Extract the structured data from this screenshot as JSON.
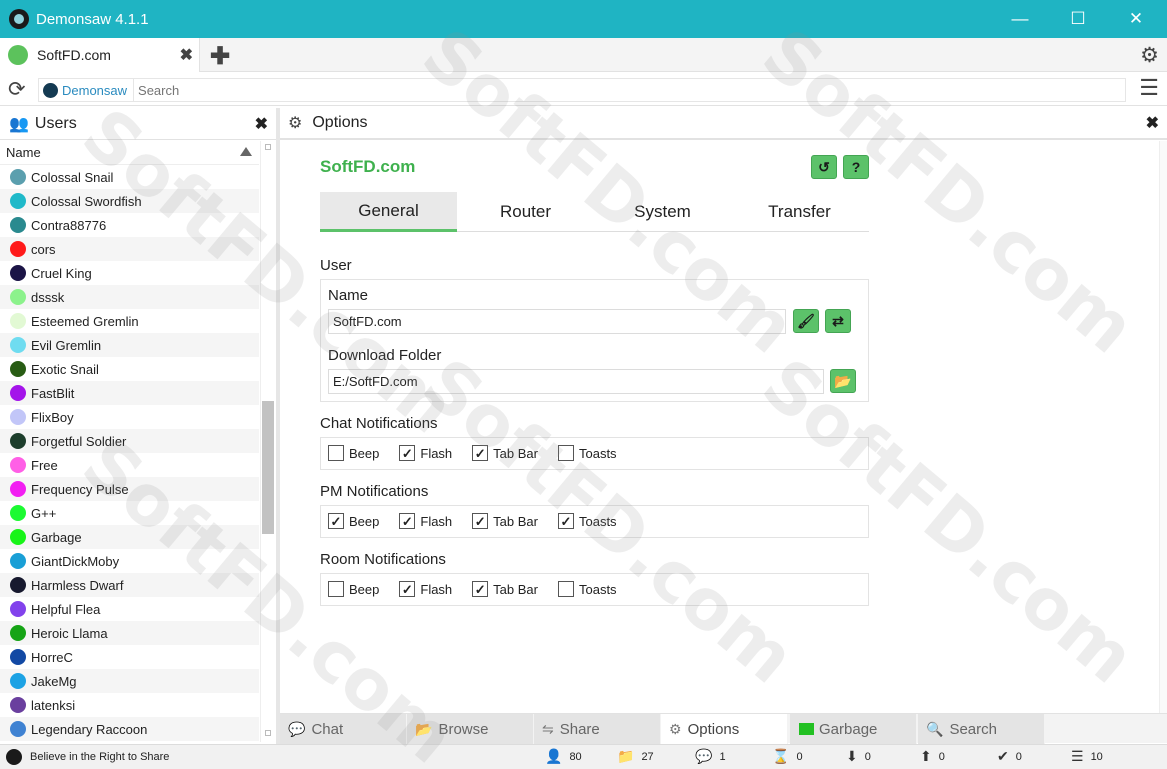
{
  "window": {
    "title": "Demonsaw 4.1.1",
    "minimize": "—",
    "maximize": "☐",
    "close": "✕"
  },
  "tab": {
    "label": "SoftFD.com",
    "close": "✖",
    "add": "✚"
  },
  "address": {
    "site": "Demonsaw",
    "placeholder": "Search"
  },
  "users": {
    "title": "Users",
    "column": "Name",
    "list": [
      {
        "name": "Colossal Snail",
        "color": "#5b9fae"
      },
      {
        "name": "Colossal Swordfish",
        "color": "#1fb9c9"
      },
      {
        "name": "Contra88776",
        "color": "#2a8a8f"
      },
      {
        "name": "cors",
        "color": "#ff1a1a"
      },
      {
        "name": "Cruel King",
        "color": "#1b1446"
      },
      {
        "name": "dsssk",
        "color": "#8cf28c"
      },
      {
        "name": "Esteemed Gremlin",
        "color": "#e2f9d4"
      },
      {
        "name": "Evil Gremlin",
        "color": "#6fdcf0"
      },
      {
        "name": "Exotic Snail",
        "color": "#285c14"
      },
      {
        "name": "FastBlit",
        "color": "#a414ea"
      },
      {
        "name": "FlixBoy",
        "color": "#c2c6f8"
      },
      {
        "name": "Forgetful Soldier",
        "color": "#1d3e2c"
      },
      {
        "name": "Free",
        "color": "#ff5fe6"
      },
      {
        "name": "Frequency Pulse",
        "color": "#f21ef2"
      },
      {
        "name": "G++",
        "color": "#1cfa32"
      },
      {
        "name": "Garbage",
        "color": "#18f418"
      },
      {
        "name": "GiantDickMoby",
        "color": "#199fd6"
      },
      {
        "name": "Harmless Dwarf",
        "color": "#17192e"
      },
      {
        "name": "Helpful Flea",
        "color": "#8242ec"
      },
      {
        "name": "Heroic Llama",
        "color": "#16a416"
      },
      {
        "name": "HorreC",
        "color": "#1249a4"
      },
      {
        "name": "JakeMg",
        "color": "#1ca2e4"
      },
      {
        "name": "latenksi",
        "color": "#6a3f9e"
      },
      {
        "name": "Legendary Raccoon",
        "color": "#3f82d2"
      }
    ]
  },
  "options": {
    "header": "Options",
    "title": "SoftFD.com",
    "tabs": [
      "General",
      "Router",
      "System",
      "Transfer"
    ],
    "user_section": "User",
    "name_label": "Name",
    "name_value": "SoftFD.com",
    "download_label": "Download Folder",
    "download_value": "E:/SoftFD.com",
    "notifications": [
      {
        "title": "Chat Notifications",
        "items": [
          {
            "label": "Beep",
            "checked": false
          },
          {
            "label": "Flash",
            "checked": true
          },
          {
            "label": "Tab Bar",
            "checked": true
          },
          {
            "label": "Toasts",
            "checked": false
          }
        ]
      },
      {
        "title": "PM Notifications",
        "items": [
          {
            "label": "Beep",
            "checked": true
          },
          {
            "label": "Flash",
            "checked": true
          },
          {
            "label": "Tab Bar",
            "checked": true
          },
          {
            "label": "Toasts",
            "checked": true
          }
        ]
      },
      {
        "title": "Room Notifications",
        "items": [
          {
            "label": "Beep",
            "checked": false
          },
          {
            "label": "Flash",
            "checked": true
          },
          {
            "label": "Tab Bar",
            "checked": true
          },
          {
            "label": "Toasts",
            "checked": false
          }
        ]
      }
    ]
  },
  "bottom_tabs": [
    "Chat",
    "Browse",
    "Share",
    "Options",
    "Garbage",
    "Search"
  ],
  "status": {
    "motto": "Believe in the Right to Share",
    "users": "80",
    "folders": "27",
    "chats": "1",
    "queued": "0",
    "downloads": "0",
    "uploads": "0",
    "finished": "0",
    "threads": "10"
  },
  "watermark": "SoftFD.com",
  "colors": {
    "accent": "#1fb4c3",
    "green": "#5cc26a",
    "title_green": "#3fb14e"
  }
}
